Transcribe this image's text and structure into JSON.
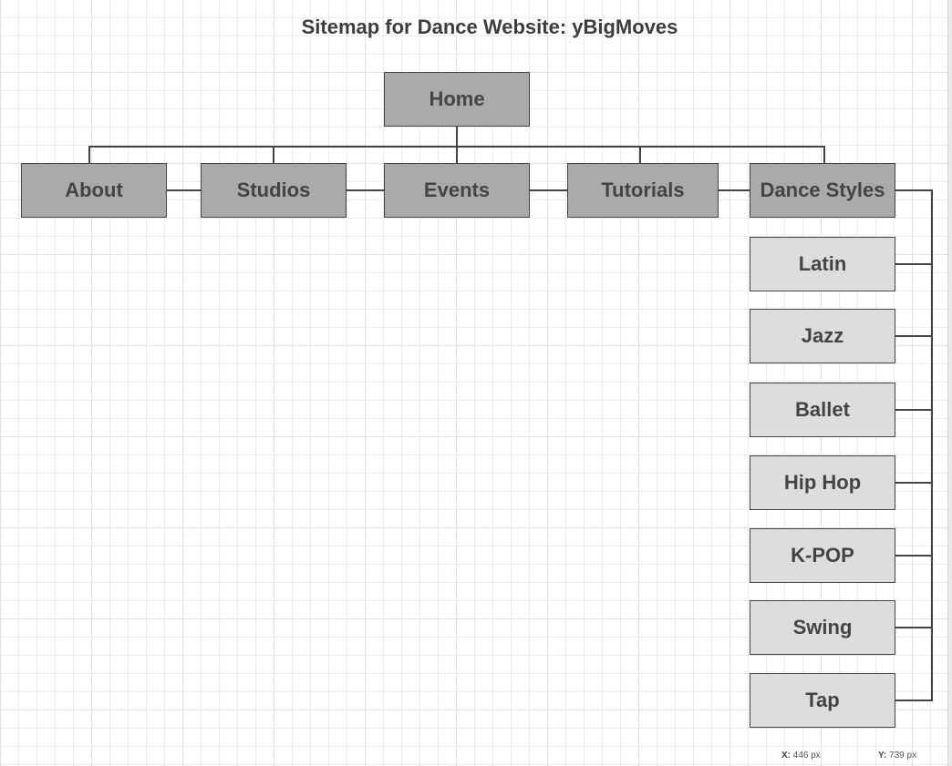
{
  "diagram": {
    "title": "Sitemap for Dance Website: yBigMoves",
    "root": {
      "id": "home",
      "label": "Home"
    },
    "sections": [
      {
        "id": "about",
        "label": "About"
      },
      {
        "id": "studios",
        "label": "Studios"
      },
      {
        "id": "events",
        "label": "Events"
      },
      {
        "id": "tutorials",
        "label": "Tutorials"
      },
      {
        "id": "dance-styles",
        "label": "Dance Styles"
      }
    ],
    "dance_styles_children": [
      {
        "id": "latin",
        "label": "Latin"
      },
      {
        "id": "jazz",
        "label": "Jazz"
      },
      {
        "id": "ballet",
        "label": "Ballet"
      },
      {
        "id": "hip-hop",
        "label": "Hip Hop"
      },
      {
        "id": "k-pop",
        "label": "K-POP"
      },
      {
        "id": "swing",
        "label": "Swing"
      },
      {
        "id": "tap",
        "label": "Tap"
      }
    ],
    "colors": {
      "primary_fill": "#aaaaaa",
      "child_fill": "#dddddd",
      "stroke": "#444444",
      "text": "#444444"
    }
  },
  "status": {
    "x_label": "X:",
    "x_value": "446 px",
    "y_label": "Y:",
    "y_value": "739 px"
  }
}
